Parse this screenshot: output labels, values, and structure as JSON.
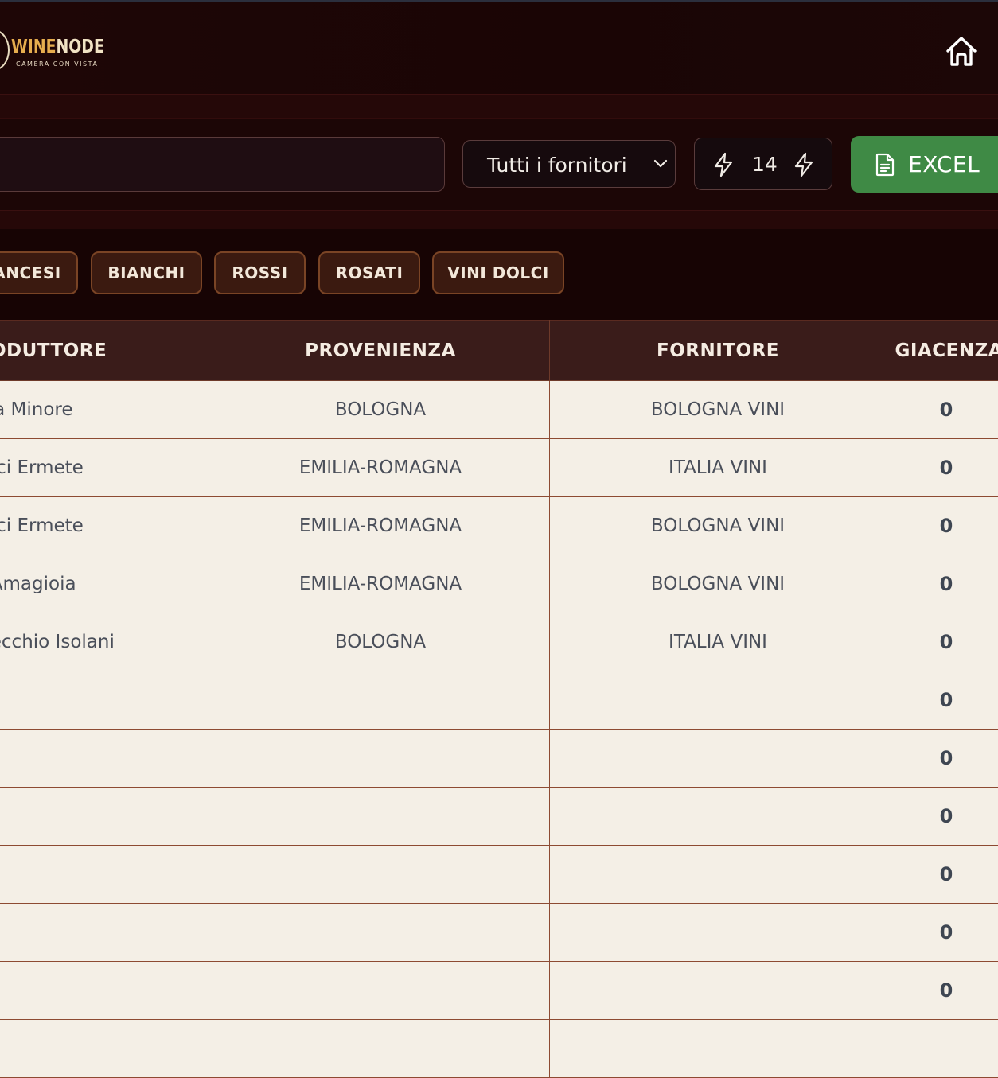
{
  "brand": {
    "name_part1": "WINE",
    "name_part2": "NODE",
    "tagline": "CAMERA CON VISTA"
  },
  "toolbar": {
    "search_value": "",
    "supplier_select": {
      "selected": "Tutti i fornitori"
    },
    "counter_value": "14",
    "excel_label": "EXCEL"
  },
  "chips": [
    "ANCESI",
    "BIANCHI",
    "ROSSI",
    "ROSATI",
    "VINI DOLCI"
  ],
  "table": {
    "headers": {
      "produttore": "ODUTTORE",
      "provenienza": "PROVENIENZA",
      "fornitore": "FORNITORE",
      "giacenza": "GIACENZA"
    },
    "rows": [
      {
        "produttore": "atta Minore",
        "provenienza": "BOLOGNA",
        "fornitore": "BOLOGNA VINI",
        "giacenza": "0"
      },
      {
        "produttore": "edici Ermete",
        "provenienza": "EMILIA-ROMAGNA",
        "fornitore": "ITALIA VINI",
        "giacenza": "0"
      },
      {
        "produttore": "edici Ermete",
        "provenienza": "EMILIA-ROMAGNA",
        "fornitore": "BOLOGNA VINI",
        "giacenza": "0"
      },
      {
        "produttore": "la Amagioia",
        "provenienza": "EMILIA-ROMAGNA",
        "fornitore": "BOLOGNA VINI",
        "giacenza": "0"
      },
      {
        "produttore": "evecchio Isolani",
        "provenienza": "BOLOGNA",
        "fornitore": "ITALIA VINI",
        "giacenza": "0"
      },
      {
        "produttore": "",
        "provenienza": "",
        "fornitore": "",
        "giacenza": "0"
      },
      {
        "produttore": "",
        "provenienza": "",
        "fornitore": "",
        "giacenza": "0"
      },
      {
        "produttore": "",
        "provenienza": "",
        "fornitore": "",
        "giacenza": "0"
      },
      {
        "produttore": "",
        "provenienza": "",
        "fornitore": "",
        "giacenza": "0"
      },
      {
        "produttore": "",
        "provenienza": "",
        "fornitore": "",
        "giacenza": "0"
      },
      {
        "produttore": "",
        "provenienza": "",
        "fornitore": "",
        "giacenza": "0"
      },
      {
        "produttore": "",
        "provenienza": "",
        "fornitore": "",
        "giacenza": ""
      }
    ]
  },
  "colors": {
    "accent_green": "#3f8a45",
    "header_bg": "#1a0505",
    "chip_bg": "#3b1a10",
    "row_bg": "#f4efe6"
  }
}
